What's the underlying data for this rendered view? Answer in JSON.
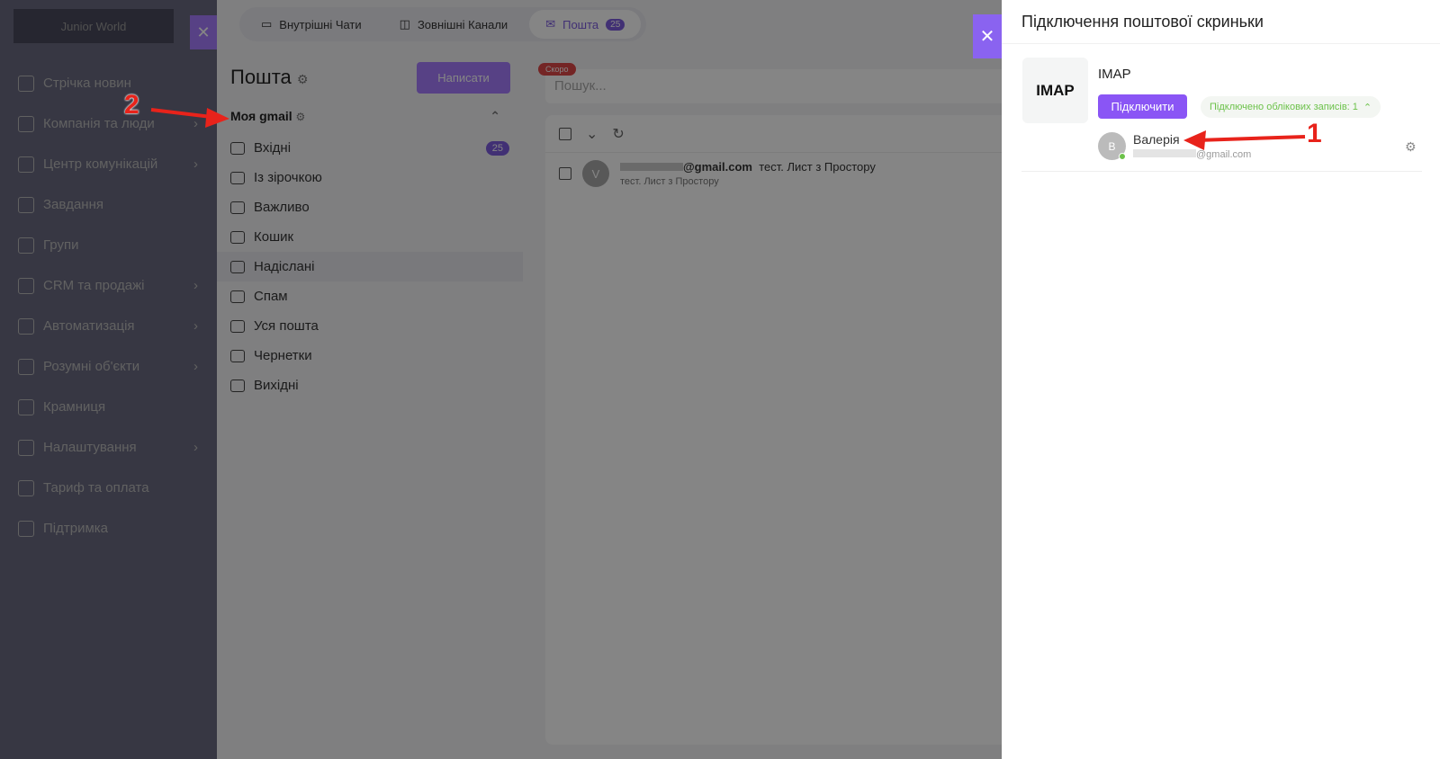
{
  "sidebar": {
    "logo": "Junior World",
    "items": [
      {
        "label": "Стрічка новин"
      },
      {
        "label": "Компанія та люди",
        "chev": true
      },
      {
        "label": "Центр комунікацій",
        "chev": true
      },
      {
        "label": "Завдання"
      },
      {
        "label": "Групи"
      },
      {
        "label": "CRM та продажі",
        "chev": true
      },
      {
        "label": "Автоматизація",
        "chev": true
      },
      {
        "label": "Розумні об'єкти",
        "chev": true
      },
      {
        "label": "Крамниця"
      },
      {
        "label": "Налаштування",
        "chev": true
      },
      {
        "label": "Тариф та оплата"
      },
      {
        "label": "Підтримка"
      }
    ]
  },
  "tabs": [
    {
      "label": "Внутрішні Чати"
    },
    {
      "label": "Зовнішні Канали"
    },
    {
      "label": "Пошта",
      "badge": "25"
    }
  ],
  "mail": {
    "title": "Пошта",
    "compose": "Написати",
    "account": "Моя gmail",
    "folders": [
      {
        "label": "Вхідні",
        "count": "25"
      },
      {
        "label": "Із зірочкою"
      },
      {
        "label": "Важливо"
      },
      {
        "label": "Кошик"
      },
      {
        "label": "Надіслані"
      },
      {
        "label": "Спам"
      },
      {
        "label": "Уся пошта"
      },
      {
        "label": "Чернетки"
      },
      {
        "label": "Вихідні"
      }
    ],
    "soon_badge": "Скоро",
    "search_placeholder": "Пошук...",
    "message": {
      "avatar": "V",
      "from": "@gmail.com",
      "subject": "тест. Лист з Простору",
      "preview": "тест. Лист з Простору"
    }
  },
  "panel": {
    "title": "Підключення поштової скриньки",
    "provider_logo": "IMAP",
    "provider": "IMAP",
    "connect": "Підключити",
    "connected": "Підключено облікових записів: 1",
    "account": {
      "avatar": "В",
      "name": "Валерія",
      "email": "@gmail.com"
    }
  },
  "annotations": {
    "a1": "1",
    "a2": "2"
  }
}
